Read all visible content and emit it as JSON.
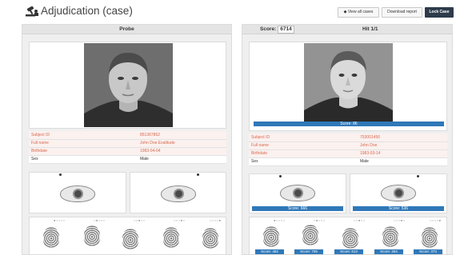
{
  "header": {
    "title": "Adjudication (case)",
    "app_icon": "judge-gavel-icon",
    "buttons": {
      "view_all": "◆ View all cases",
      "download": "Download report",
      "lock": "Lock Case"
    }
  },
  "probe": {
    "title": "Probe",
    "rows": [
      {
        "label": "Subject ID",
        "value": "851367862",
        "highlight": true
      },
      {
        "label": "Full name",
        "value": "John Doe Exatitude",
        "highlight": true
      },
      {
        "label": "Birthdate",
        "value": "1983-04-04",
        "highlight": true
      },
      {
        "label": "Sex",
        "value": "Male",
        "highlight": false
      }
    ]
  },
  "hit": {
    "score_label": "Score:",
    "score": "6714",
    "title": "Hit 1/1",
    "photo_score": "Score: 86",
    "rows": [
      {
        "label": "Subject ID",
        "value": "753001456",
        "highlight": true
      },
      {
        "label": "Full name",
        "value": "John Doe",
        "highlight": true
      },
      {
        "label": "Birthdate",
        "value": "1983-03-14",
        "highlight": true
      },
      {
        "label": "Sex",
        "value": "Male",
        "highlight": false
      }
    ],
    "iris_scores": [
      "Score: 666",
      "Score: 536"
    ],
    "finger_scores": [
      "Score: 462",
      "Score: 706",
      "Score: 613",
      "Score: 264",
      "Score: 373"
    ]
  },
  "colors": {
    "accent_blue": "#2f78b8",
    "highlight_text": "#d96a50",
    "lock_button": "#2d3b4a"
  }
}
